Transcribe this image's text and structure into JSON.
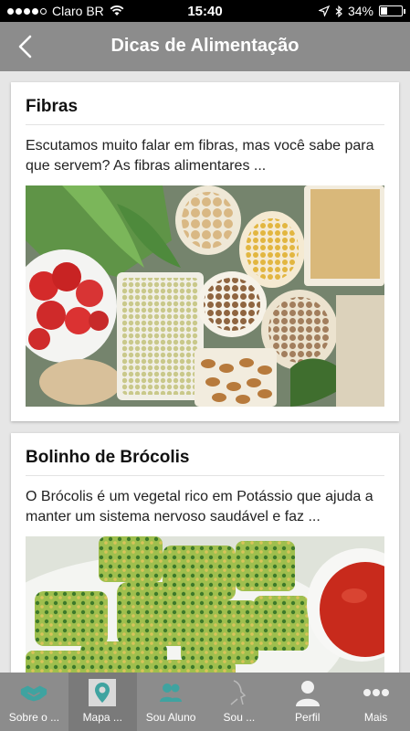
{
  "status": {
    "carrier": "Claro BR",
    "time": "15:40",
    "battery": "34%",
    "battery_level": 0.34
  },
  "nav": {
    "title": "Dicas de Alimentação"
  },
  "cards": [
    {
      "title": "Fibras",
      "text": "Escutamos muito falar em fibras, mas você sabe para que servem? As fibras alimentares ..."
    },
    {
      "title": "Bolinho de Brócolis",
      "text": "O Brócolis é um vegetal rico em Potássio que ajuda a manter um sistema nervoso saudável e faz ..."
    }
  ],
  "tabs": [
    {
      "label": "Sobre o ...",
      "icon": "handshake-icon"
    },
    {
      "label": "Mapa ...",
      "icon": "map-pin-icon"
    },
    {
      "label": "Sou Aluno",
      "icon": "users-icon"
    },
    {
      "label": "Sou ...",
      "icon": "profile-silhouette-icon"
    },
    {
      "label": "Perfil",
      "icon": "person-icon"
    },
    {
      "label": "Mais",
      "icon": "more-dots-icon"
    }
  ],
  "colors": {
    "accent": "#3fa3a0",
    "nav_bg": "#8c8c8c"
  }
}
